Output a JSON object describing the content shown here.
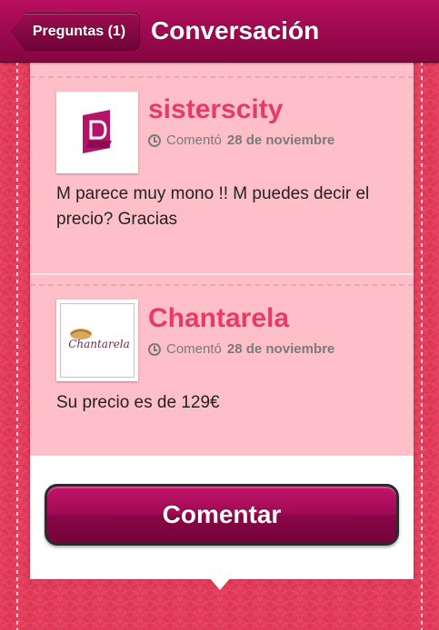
{
  "navbar": {
    "back_label": "Preguntas (1)",
    "title": "Conversación"
  },
  "comments": [
    {
      "author": "sisterscity",
      "commented_label": "Comentó",
      "date": "28 de noviembre",
      "text": "M parece muy mono !! M puedes decir el precio? Gracias",
      "avatar_letter": "D"
    },
    {
      "author": "Chantarela",
      "commented_label": "Comentó",
      "date": "28 de noviembre",
      "text": "Su precio es de 129€",
      "avatar_text": "Chantarela"
    }
  ],
  "actions": {
    "comment_button_label": "Comentar"
  },
  "colors": {
    "brand": "#a00a52",
    "author": "#e83a64",
    "comment_bg": "#ffbfc8"
  }
}
